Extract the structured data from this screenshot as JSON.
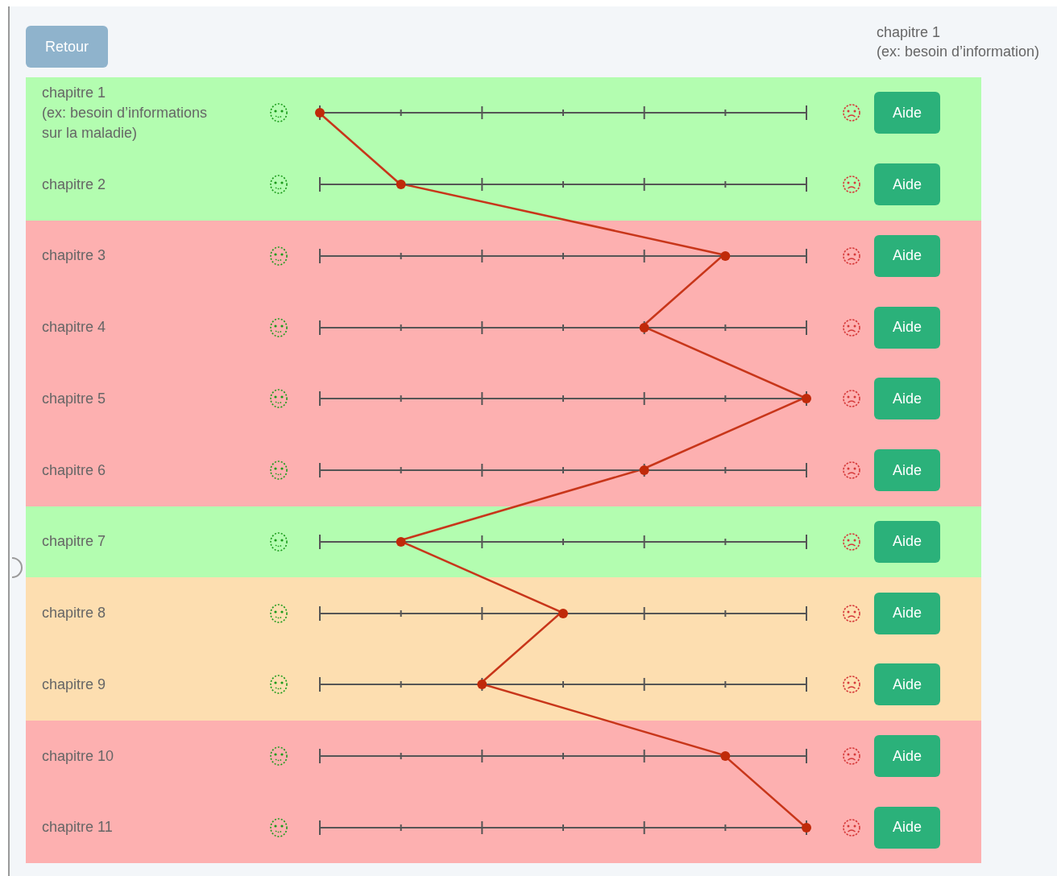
{
  "back_button": {
    "label": "Retour"
  },
  "legend": {
    "title": "chapitre 1",
    "example": "(ex: besoin d’information)"
  },
  "groups": [
    {
      "color": "#b3fdb0",
      "rows": [
        {
          "label": "chapitre 1\n(ex: besoin d’informations\nsur la maladie)",
          "level": 0,
          "button": "Aide"
        },
        {
          "label": "chapitre 2",
          "level": 0.1667,
          "button": "Aide"
        }
      ]
    },
    {
      "color": "#fdb0b0",
      "rows": [
        {
          "label": "chapitre 3",
          "level": 0.8333,
          "button": "Aide"
        },
        {
          "label": "chapitre 4",
          "level": 0.6667,
          "button": "Aide"
        },
        {
          "label": "chapitre 5",
          "level": 1,
          "button": "Aide"
        },
        {
          "label": "chapitre 6",
          "level": 0.6667,
          "button": "Aide"
        }
      ]
    },
    {
      "color": "#b3fdb0",
      "rows": [
        {
          "label": "chapitre 7",
          "level": 0.1667,
          "button": "Aide"
        }
      ]
    },
    {
      "color": "#fddeb0",
      "rows": [
        {
          "label": "chapitre 8",
          "level": 0.5,
          "button": "Aide"
        },
        {
          "label": "chapitre 9",
          "level": 0.3333,
          "button": "Aide"
        }
      ]
    },
    {
      "color": "#fdb0b0",
      "rows": [
        {
          "label": "chapitre 10",
          "level": 0.8333,
          "button": "Aide"
        },
        {
          "label": "chapitre 11",
          "level": 1,
          "button": "Aide"
        }
      ]
    }
  ]
}
